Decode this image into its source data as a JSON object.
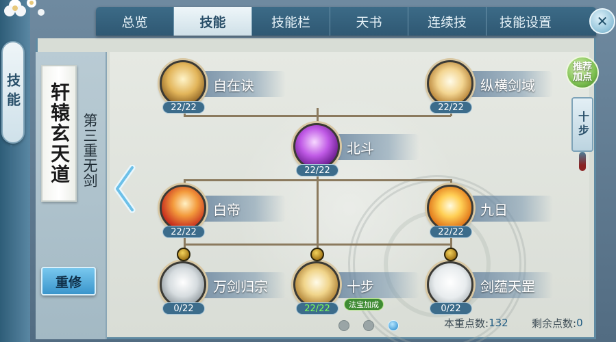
{
  "sidebar": {
    "tab_label": "技能"
  },
  "tabs": [
    {
      "label": "总览",
      "active": false
    },
    {
      "label": "技能",
      "active": true
    },
    {
      "label": "技能栏",
      "active": false
    },
    {
      "label": "天书",
      "active": false
    },
    {
      "label": "连续技",
      "active": false
    },
    {
      "label": "技能设置",
      "active": false
    }
  ],
  "close_button": {
    "label": "✕"
  },
  "school": {
    "name": "轩辕玄天道",
    "realm": "第三重无剑",
    "reset_label": "重修"
  },
  "skills": [
    {
      "name": "自在诀",
      "level": "22/22",
      "icon": "golden-figure-icon"
    },
    {
      "name": "纵横剑域",
      "level": "22/22",
      "icon": "sword-burst-icon"
    },
    {
      "name": "北斗",
      "level": "22/22",
      "icon": "purple-crystal-icon"
    },
    {
      "name": "白帝",
      "level": "22/22",
      "icon": "red-slash-icon"
    },
    {
      "name": "九日",
      "level": "22/22",
      "icon": "golden-sun-icon"
    },
    {
      "name": "万剑归宗",
      "level": "0/22",
      "icon": "silver-swords-icon",
      "locked": true
    },
    {
      "name": "十步",
      "level": "22/22",
      "level_note": "法宝加成",
      "icon": "golden-sword-icon",
      "locked": true
    },
    {
      "name": "剑蕴天罡",
      "level": "0/22",
      "icon": "white-orb-icon",
      "locked": true
    }
  ],
  "right_panel": {
    "recommend_label": "推荐加点",
    "plan_label": "十步"
  },
  "pager": {
    "pages": 3,
    "current": 3
  },
  "stats": {
    "used_label": "本重点数:",
    "used_value": "132",
    "remaining_label": "剩余点数:",
    "remaining_value": "0"
  },
  "colors": {
    "tab_bar": "#3c6b87",
    "active_tab": "#eef6f9",
    "reset_button": "#3a95cc",
    "level_pill": "#3c6c8b",
    "bonus_level_text": "#7dff5a",
    "bonus_badge": "#3f8b34"
  }
}
